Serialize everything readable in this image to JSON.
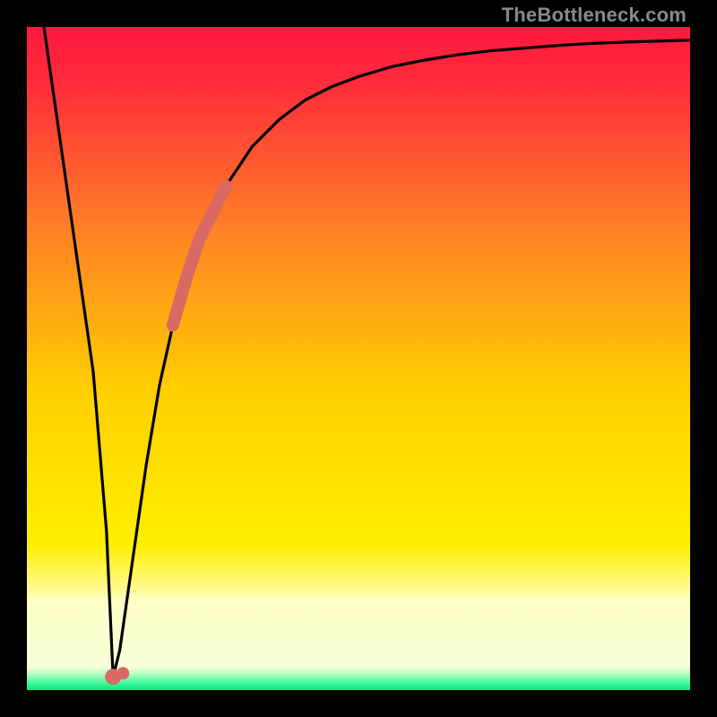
{
  "watermark": "TheBottleneck.com",
  "colors": {
    "frame": "#000000",
    "grad_top": "#ff193f",
    "grad_mid": "#ffcf00",
    "grad_green": "#00e978",
    "curve": "#000000",
    "marker": "#d96a63"
  },
  "chart_data": {
    "type": "line",
    "title": "",
    "xlabel": "",
    "ylabel": "",
    "xlim": [
      0,
      100
    ],
    "ylim": [
      0,
      100
    ],
    "series": [
      {
        "name": "bottleneck-curve",
        "x": [
          0,
          2,
          4,
          6,
          8,
          10,
          12,
          13,
          14,
          16,
          18,
          20,
          22,
          24,
          26,
          28,
          30,
          34,
          38,
          42,
          46,
          50,
          55,
          60,
          65,
          70,
          75,
          80,
          85,
          90,
          95,
          100
        ],
        "y": [
          118,
          104,
          90,
          76,
          62,
          48,
          24,
          2,
          6,
          20,
          34,
          46,
          55,
          62,
          68,
          72,
          76,
          82,
          86,
          89,
          91,
          92.5,
          94,
          95,
          95.8,
          96.4,
          96.8,
          97.2,
          97.5,
          97.7,
          97.85,
          98
        ]
      }
    ],
    "markers": {
      "name": "highlight-segment",
      "x": [
        13,
        22,
        23,
        24,
        25,
        26,
        27,
        28,
        29,
        30
      ],
      "y": [
        2,
        55,
        58.5,
        62,
        65,
        68,
        70,
        72,
        74,
        76
      ]
    },
    "annotations": []
  }
}
